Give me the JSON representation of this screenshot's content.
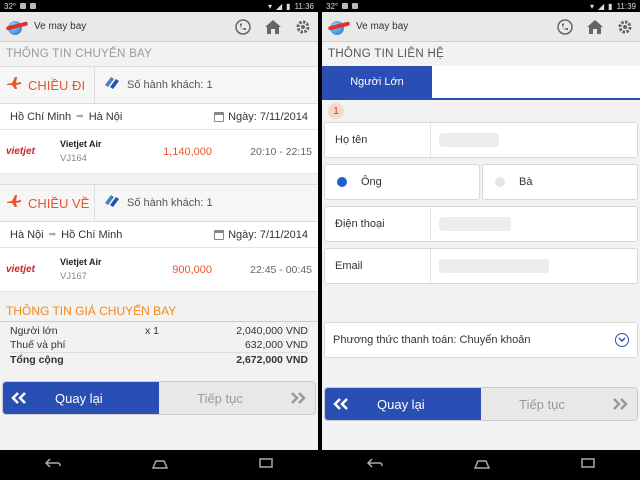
{
  "left": {
    "status": {
      "left": "32°",
      "time": "11:36"
    },
    "app": {
      "title": "Ve may bay"
    },
    "section_title": "THÔNG TIN CHUYẾN BAY",
    "outbound": {
      "label": "CHIỀU ĐI",
      "pax": "Số hành khách: 1",
      "from": "Hồ Chí Minh",
      "to": "Hà Nội",
      "date": "Ngày: 7/11/2014",
      "airline_logo": "vietjet",
      "airline": "Vietjet Air",
      "code": "VJ164",
      "price": "1,140,000",
      "time": "20:10 - 22:15"
    },
    "return": {
      "label": "CHIỀU VỀ",
      "pax": "Số hành khách: 1",
      "from": "Hà Nội",
      "to": "Hồ Chí Minh",
      "date": "Ngày: 7/11/2014",
      "airline_logo": "vietjet",
      "airline": "Vietjet Air",
      "code": "VJ167",
      "price": "900,000",
      "time": "22:45 - 00:45"
    },
    "price_section": {
      "title": "THÔNG TIN GIÁ CHUYẾN BAY",
      "rows": [
        {
          "label": "Người lớn",
          "qty": "x 1",
          "amount": "2,040,000 VND"
        },
        {
          "label": "Thuế và phí",
          "qty": "",
          "amount": "632,000 VND"
        },
        {
          "label": "Tổng cộng",
          "qty": "",
          "amount": "2,672,000 VND"
        }
      ]
    },
    "buttons": {
      "back": "Quay lại",
      "next": "Tiếp tục"
    }
  },
  "right": {
    "status": {
      "left": "32°",
      "time": "11:39"
    },
    "app": {
      "title": "Ve may bay"
    },
    "section_title": "THÔNG TIN LIÊN HỆ",
    "tab": "Người Lớn",
    "step": "1",
    "fields": {
      "name_label": "Họ tên",
      "phone_label": "Điện thoại",
      "email_label": "Email"
    },
    "gender": {
      "male": "Ông",
      "female": "Bà"
    },
    "payment": "Phương thức thanh toán: Chuyển khoản",
    "buttons": {
      "back": "Quay lại",
      "next": "Tiếp tục"
    }
  },
  "colors": {
    "accent": "#2a4fb4",
    "orange": "#e8562a",
    "price_title": "#f08a1e"
  }
}
